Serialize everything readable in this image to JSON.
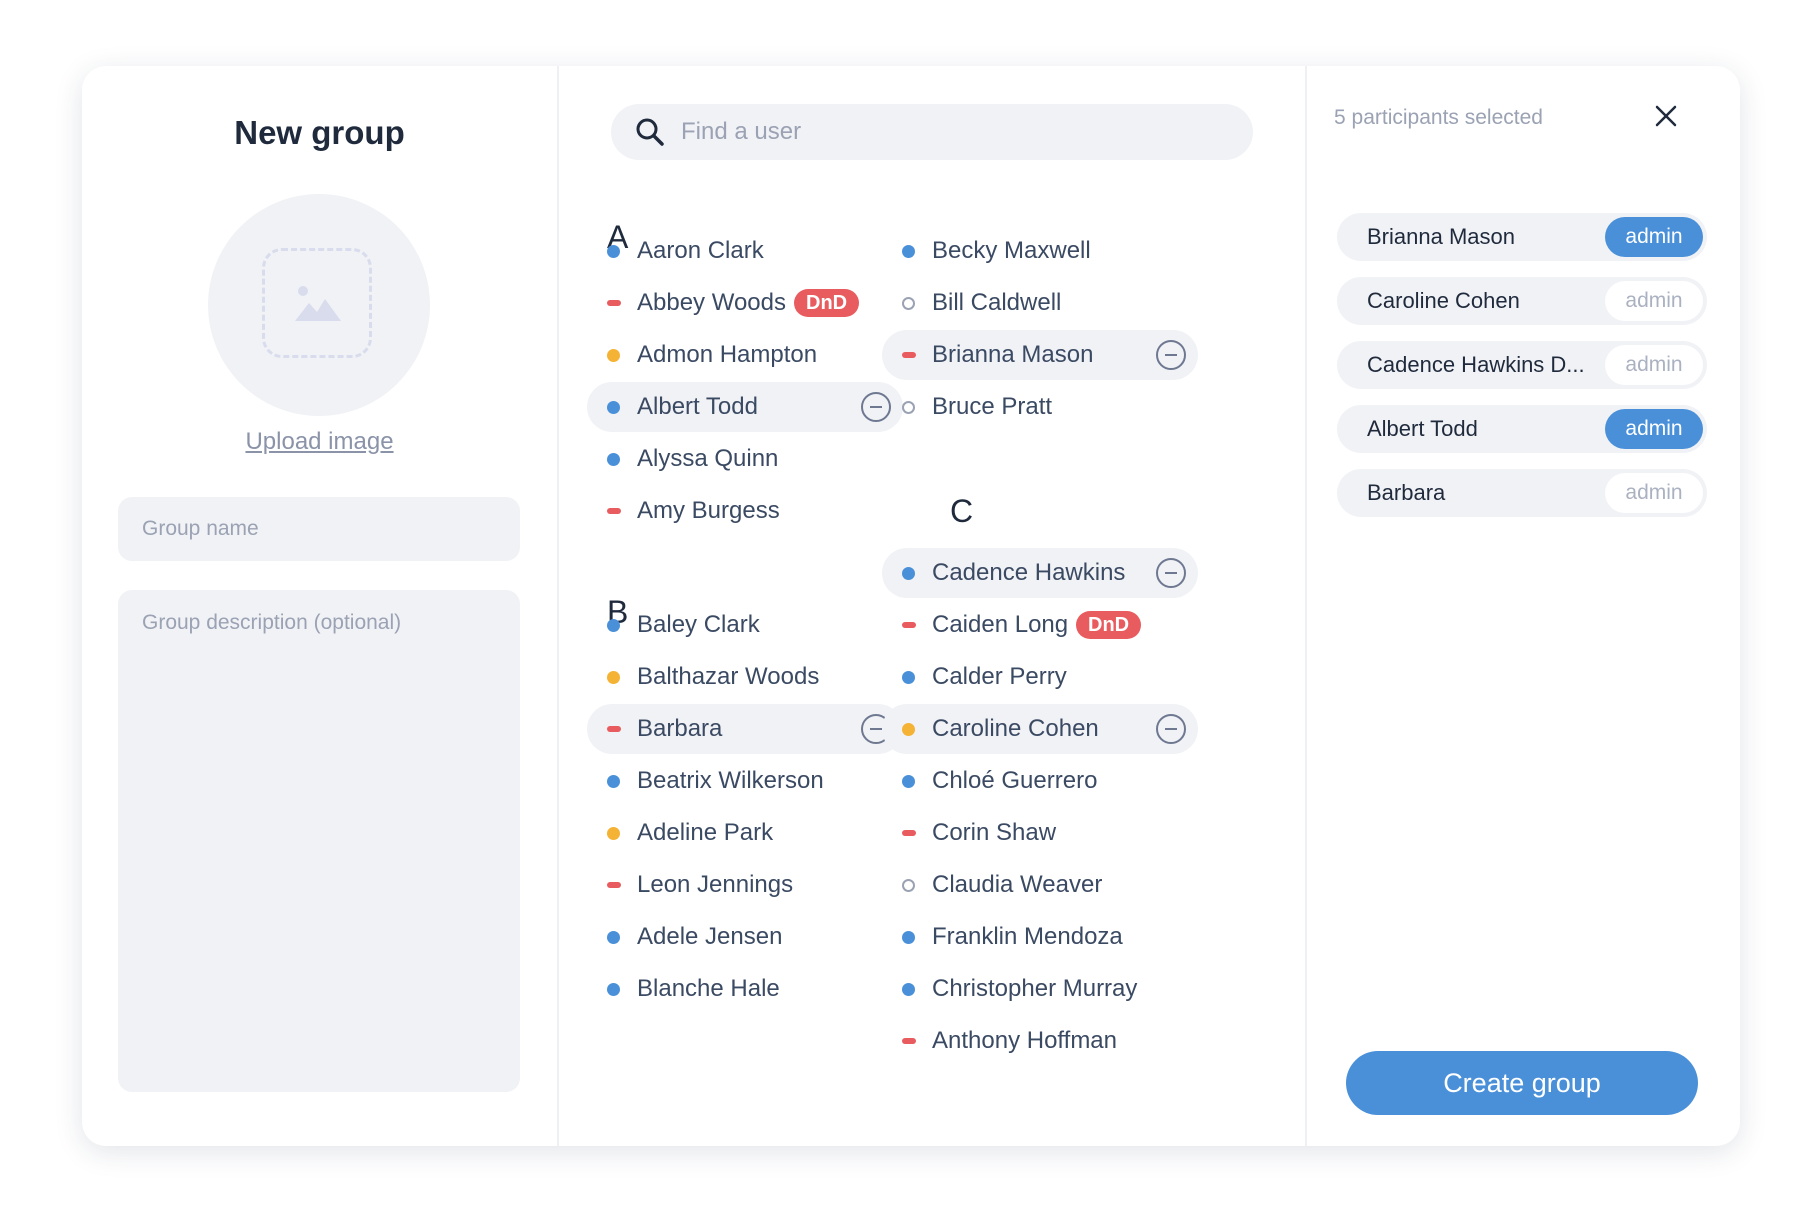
{
  "dialog": {
    "title": "New group",
    "upload_label": "Upload image",
    "group_name_placeholder": "Group name",
    "group_description_placeholder": "Group description (optional)"
  },
  "search": {
    "placeholder": "Find a user"
  },
  "letters": [
    "A",
    "B",
    "C"
  ],
  "column1": [
    {
      "name": "Aaron Clark",
      "status": "online"
    },
    {
      "name": "Abbey Woods",
      "status": "dnd",
      "badge": "DnD"
    },
    {
      "name": "Admon Hampton",
      "status": "away"
    },
    {
      "name": "Albert Todd",
      "status": "online",
      "selected": true
    },
    {
      "name": "Alyssa Quinn",
      "status": "online"
    },
    {
      "name": "Amy Burgess",
      "status": "dnd"
    },
    {
      "name": "Baley Clark",
      "status": "online"
    },
    {
      "name": "Balthazar Woods",
      "status": "away"
    },
    {
      "name": "Barbara",
      "status": "dnd",
      "selected": true
    },
    {
      "name": "Beatrix Wilkerson",
      "status": "online"
    },
    {
      "name": "Adeline Park",
      "status": "away"
    },
    {
      "name": "Leon Jennings",
      "status": "dnd"
    },
    {
      "name": "Adele Jensen",
      "status": "online"
    },
    {
      "name": "Blanche Hale",
      "status": "online"
    }
  ],
  "column2": [
    {
      "name": "Becky Maxwell",
      "status": "online"
    },
    {
      "name": "Bill Caldwell",
      "status": "offline"
    },
    {
      "name": "Brianna Mason",
      "status": "dnd",
      "selected": true
    },
    {
      "name": "Bruce Pratt",
      "status": "offline"
    },
    {
      "name": "Cadence Hawkins",
      "status": "online",
      "selected": true
    },
    {
      "name": "Caiden Long",
      "status": "dnd",
      "badge": "DnD"
    },
    {
      "name": "Calder Perry",
      "status": "online"
    },
    {
      "name": "Caroline Cohen",
      "status": "away",
      "selected": true
    },
    {
      "name": "Chloé Guerrero",
      "status": "online"
    },
    {
      "name": "Corin Shaw",
      "status": "dnd"
    },
    {
      "name": "Claudia Weaver",
      "status": "offline"
    },
    {
      "name": "Franklin Mendoza",
      "status": "online"
    },
    {
      "name": "Christopher Murray",
      "status": "online"
    },
    {
      "name": "Anthony Hoffman",
      "status": "dnd"
    }
  ],
  "participants": {
    "count_text": "5 participants selected",
    "admin_label": "admin",
    "items": [
      {
        "name": "Brianna Mason",
        "admin": true
      },
      {
        "name": "Caroline Cohen",
        "admin": false
      },
      {
        "name": "Cadence Hawkins D...",
        "admin": false
      },
      {
        "name": "Albert Todd",
        "admin": true
      },
      {
        "name": "Barbara",
        "admin": false
      }
    ]
  },
  "create_button": "Create group",
  "colors": {
    "accent": "#4a90d9",
    "online": "#4a90d9",
    "away": "#f5b335",
    "dnd": "#e85c5f"
  }
}
